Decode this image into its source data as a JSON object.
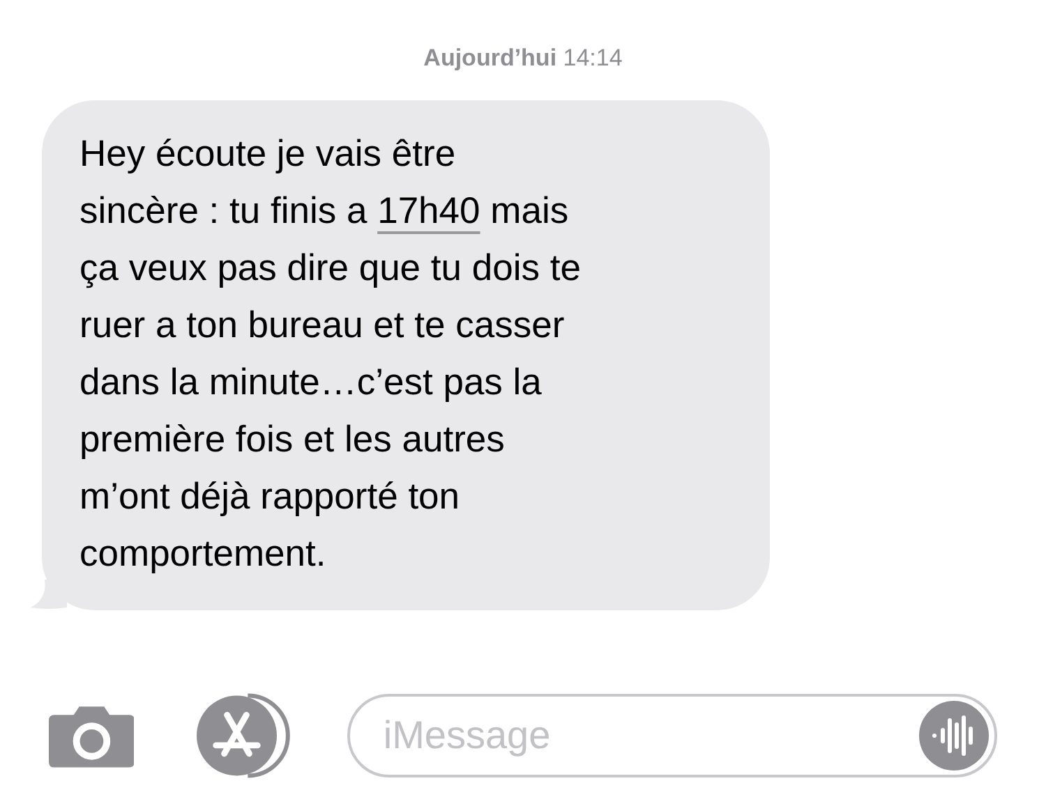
{
  "timestamp": "**Aujourd’hui** 14:14",
  "message": {
    "parts": [
      {
        "kind": "text",
        "text": "Hey écoute je vais être\nsincère : tu finis a "
      },
      {
        "kind": "link",
        "text": "17h40"
      },
      {
        "kind": "text",
        "text": " mais\nça veux pas dire que tu dois te\nruer a ton bureau et te casser\ndans la minute…c’est pas la\npremière fois et les autres\nm’ont déjà rapporté ton\ncomportement."
      }
    ]
  },
  "composer": {
    "placeholder": "iMessage"
  }
}
